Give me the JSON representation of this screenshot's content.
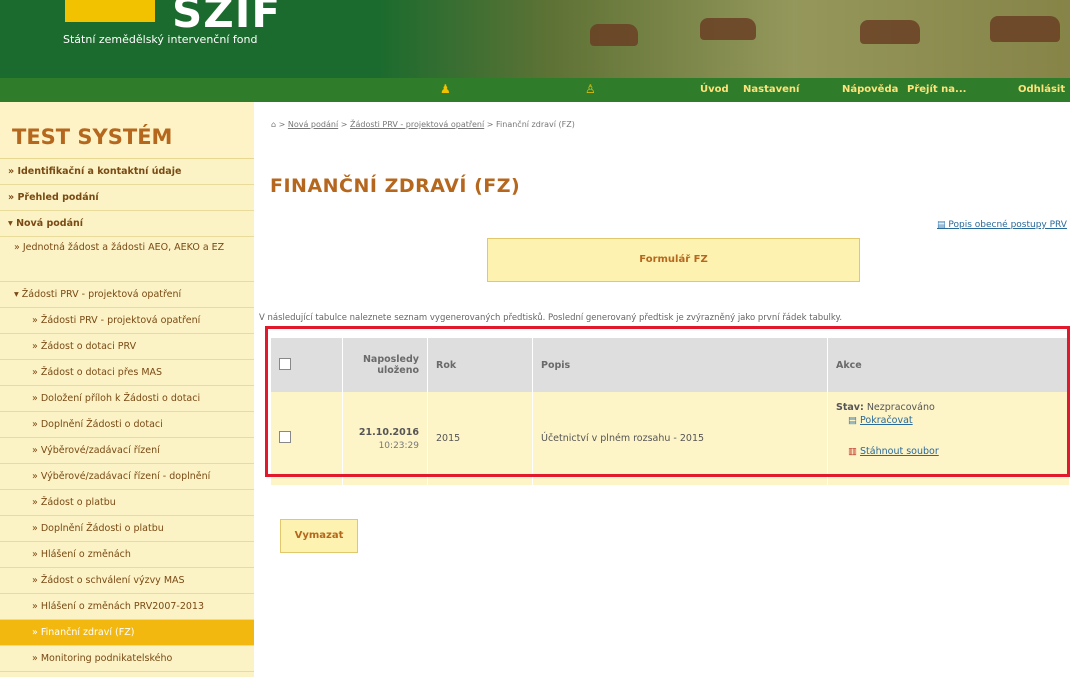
{
  "header": {
    "logo_text": "SZIF",
    "subtitle": "Státní zemědělský intervenční fond"
  },
  "topnav": {
    "items": [
      "Úvod",
      "Nastavení",
      "Nápověda",
      "Přejít na...",
      "Odhlásit"
    ]
  },
  "sidebar": {
    "title": "TEST SYSTÉM",
    "items": [
      "» Identifikační a kontaktní údaje",
      "» Přehled podání",
      "▾ Nová podání",
      "» Jednotná žádost a žádosti AEO, AEKO a EZ",
      "▾ Žádosti PRV - projektová opatření",
      "» Žádosti PRV - projektová opatření",
      "» Žádost o dotaci PRV",
      "» Žádost o dotaci přes MAS",
      "» Doložení příloh k Žádosti o dotaci",
      "» Doplnění Žádosti o dotaci",
      "» Výběrové/zadávací řízení",
      "» Výběrové/zadávací řízení - doplnění",
      "» Žádost o platbu",
      "» Doplnění Žádosti o platbu",
      "» Hlášení o změnách",
      "» Žádost o schválení výzvy MAS",
      "» Hlášení o změnách PRV2007-2013",
      "» Finanční zdraví (FZ)",
      "» Monitoring podnikatelského"
    ]
  },
  "breadcrumb": {
    "home": "⌂",
    "sep": " > ",
    "items": [
      "Nová podání",
      "Žádosti PRV - projektová opatření",
      "Finanční zdraví (FZ)"
    ]
  },
  "page_title": "FINANČNÍ ZDRAVÍ (FZ)",
  "postup_link": "Popis obecné postupy PRV",
  "form_button": "Formulář FZ",
  "info_text": "V následující tabulce naleznete seznam vygenerovaných předtisků. Poslední generovaný předtisk je zvýrazněný jako první řádek tabulky.",
  "table": {
    "headers": [
      "Naposledy uloženo",
      "Rok",
      "Popis",
      "Akce"
    ],
    "rows": [
      {
        "date": "21.10.2016",
        "time": "10:23:29",
        "year": "2015",
        "description": "Účetnictví v plném rozsahu - 2015",
        "status_label": "Stav:",
        "status_value": "Nezpracováno",
        "continue": "Pokračovat",
        "download": "Stáhnout soubor"
      }
    ]
  },
  "delete_button": "Vymazat",
  "colors": {
    "header_green": "#1c6b2e",
    "nav_green": "#2f7d2a",
    "accent_orange": "#b5671d",
    "sidebar_bg": "#fbf2c5",
    "active_item": "#f2b80f",
    "highlight_red": "#e2192c"
  }
}
